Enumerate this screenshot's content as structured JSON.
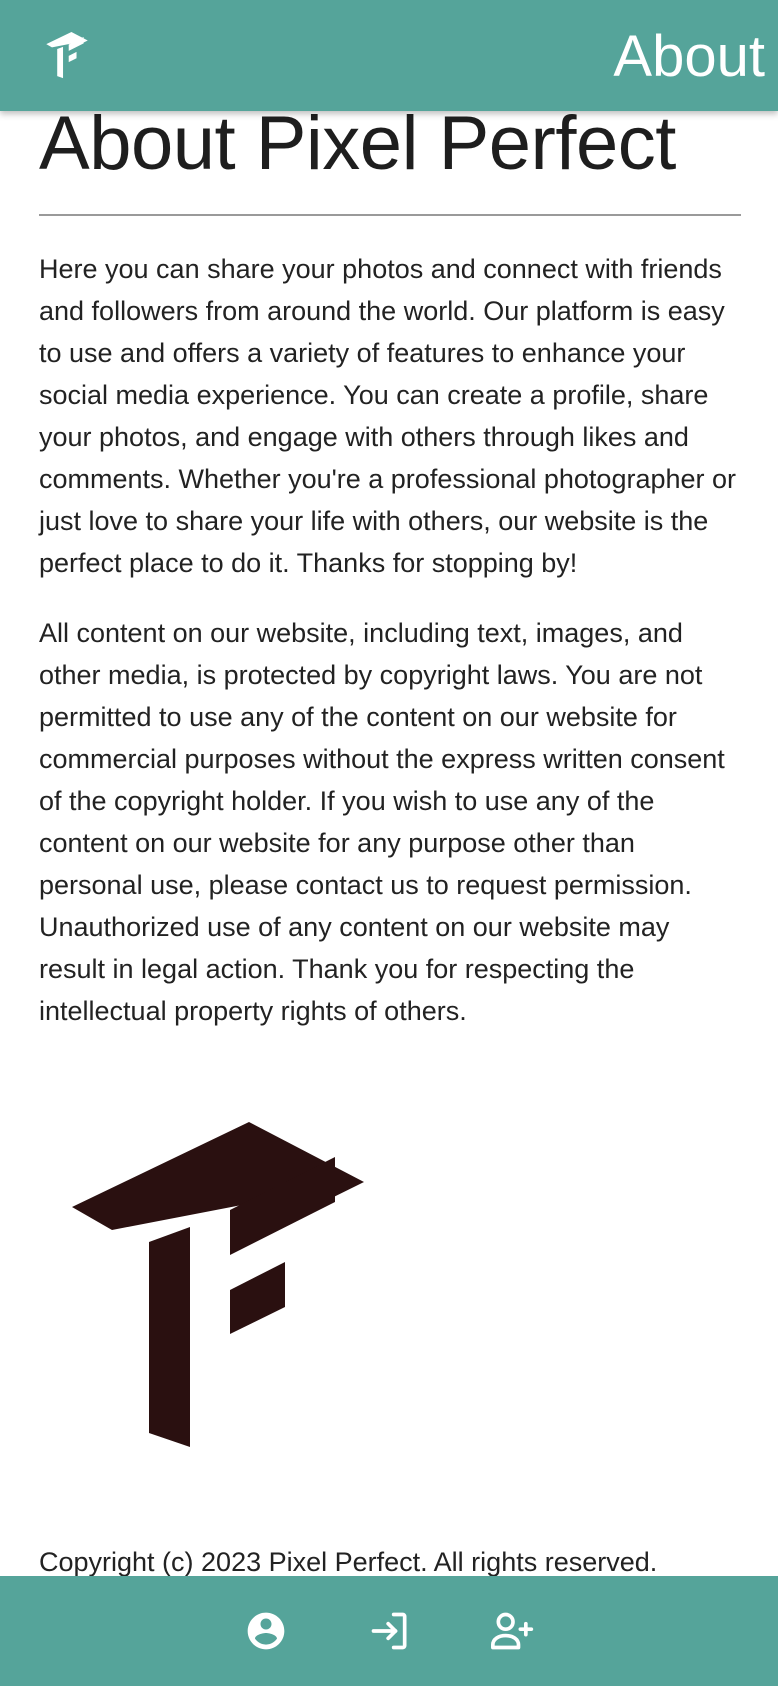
{
  "header": {
    "title": "About",
    "logo_icon": "pixel-perfect-logo-icon"
  },
  "main": {
    "heading": "About Pixel Perfect",
    "paragraphs": [
      "Here you can share your photos and connect with friends and followers from around the world. Our platform is easy to use and offers a variety of features to enhance your social media experience. You can create a profile, share your photos, and engage with others through likes and comments. Whether you're a professional photographer or just love to share your life with others, our website is the perfect place to do it. Thanks for stopping by!",
      "All content on our website, including text, images, and other media, is protected by copyright laws. You are not permitted to use any of the content on our website for commercial purposes without the express written consent of the copyright holder. If you wish to use any of the content on our website for any purpose other than personal use, please contact us to request permission. Unauthorized use of any content on our website may result in legal action. Thank you for respecting the intellectual property rights of others."
    ],
    "copyright": "Copyright (c) 2023 Pixel Perfect. All rights reserved."
  },
  "bottom_nav": {
    "items": [
      {
        "icon": "account-circle-icon"
      },
      {
        "icon": "login-icon"
      },
      {
        "icon": "add-user-icon"
      }
    ]
  },
  "colors": {
    "accent": "#55a49a",
    "logo_dark": "#2a1010",
    "text": "#222222"
  }
}
